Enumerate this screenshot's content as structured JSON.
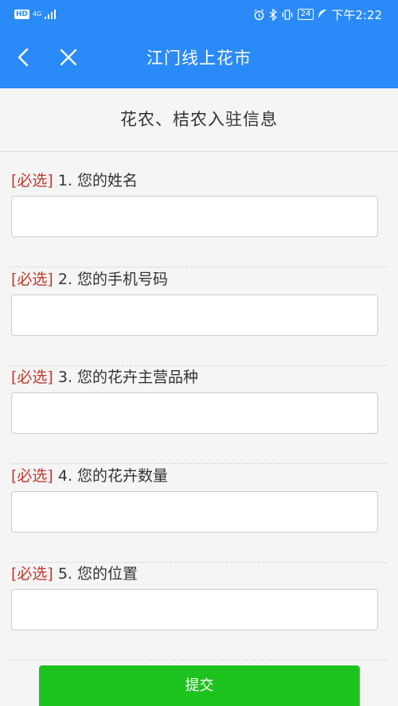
{
  "status_bar": {
    "left_badge": "HD",
    "network": "4G",
    "time": "下午2:22",
    "battery": "24"
  },
  "nav": {
    "title": "江门线上花市"
  },
  "form": {
    "title": "花农、桔农入驻信息",
    "required_tag": "[必选]",
    "fields": [
      {
        "label": "1. 您的姓名",
        "value": ""
      },
      {
        "label": "2. 您的手机号码",
        "value": ""
      },
      {
        "label": "3. 您的花卉主营品种",
        "value": ""
      },
      {
        "label": "4. 您的花卉数量",
        "value": ""
      },
      {
        "label": "5. 您的位置",
        "value": ""
      }
    ],
    "submit_label": "提交"
  },
  "colors": {
    "header": "#2a8af7",
    "required": "#c0392b",
    "submit": "#1ec21e"
  }
}
